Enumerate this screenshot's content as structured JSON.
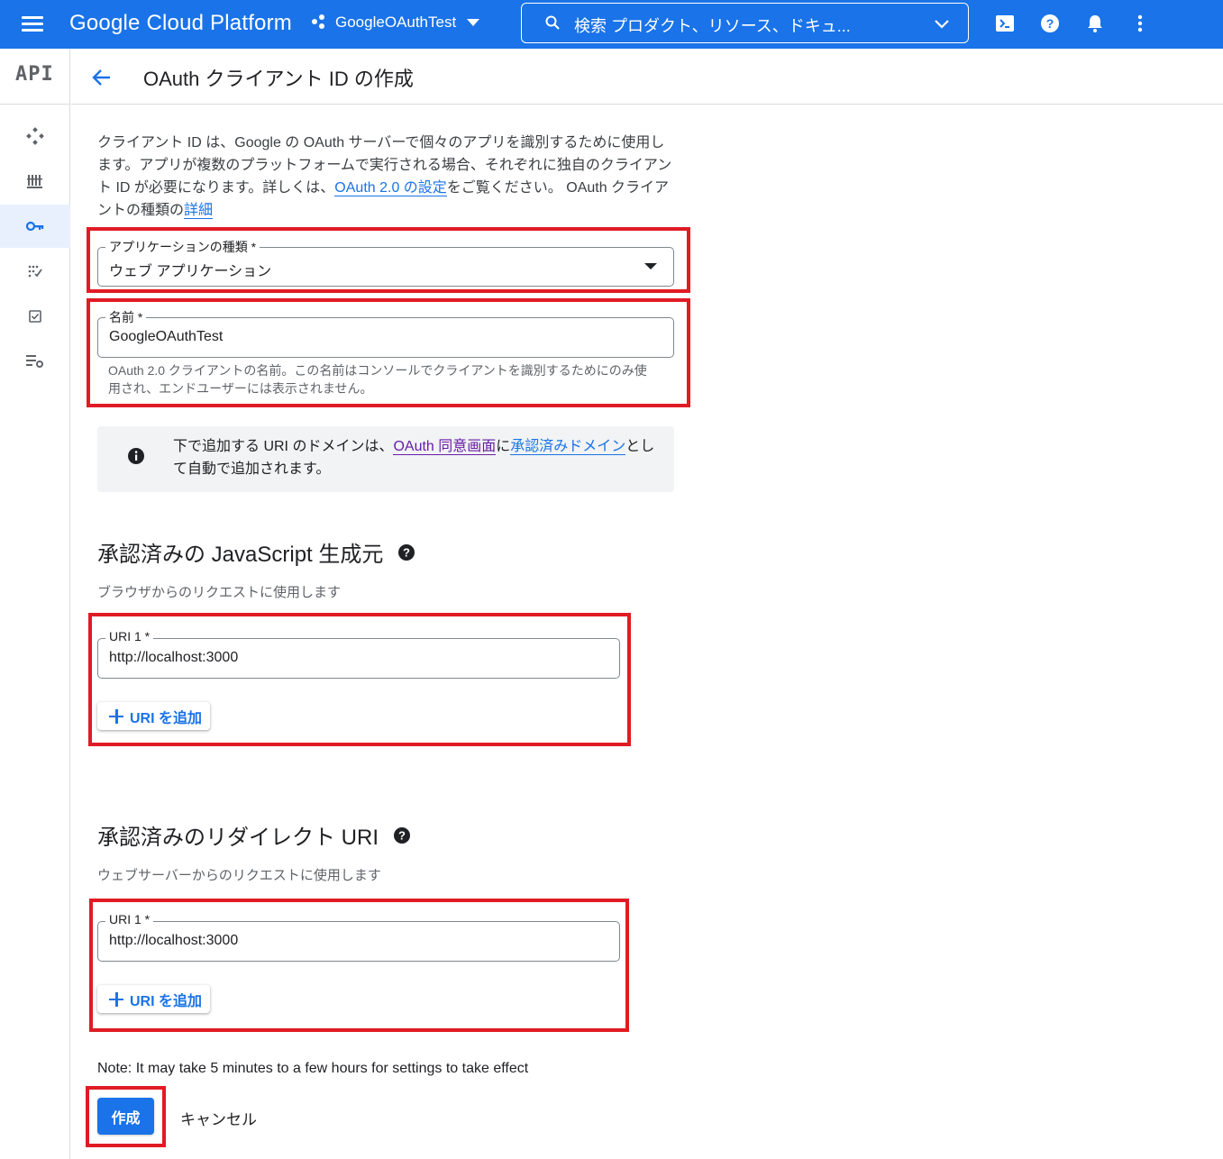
{
  "topbar": {
    "brand": "Google Cloud Platform",
    "project": "GoogleOAuthTest",
    "search_text": "検索  プロダクト、リソース、ドキュ..."
  },
  "rail": {
    "logo": "API",
    "items": [
      {
        "icon": "dashboard-icon"
      },
      {
        "icon": "library-icon"
      },
      {
        "icon": "key-icon",
        "active": true
      },
      {
        "icon": "consent-icon"
      },
      {
        "icon": "checkbox-icon"
      },
      {
        "icon": "settings-list-icon"
      }
    ]
  },
  "header": {
    "title": "OAuth クライアント ID の作成"
  },
  "intro": {
    "text1": "クライアント ID は、Google の OAuth サーバーで個々のアプリを識別するために使用します。アプリが複数のプラットフォームで実行される場合、それぞれに独自のクライアント ID が必要になります。詳しくは、",
    "link1": "OAuth 2.0 の設定",
    "text2": "をご覧ください。 OAuth クライアントの種類の",
    "link2": "詳細"
  },
  "app_type": {
    "label": "アプリケーションの種類 *",
    "value": "ウェブ アプリケーション"
  },
  "name_field": {
    "label": "名前 *",
    "value": "GoogleOAuthTest",
    "hint": "OAuth 2.0 クライアントの名前。この名前はコンソールでクライアントを識別するためにのみ使用され、エンドユーザーには表示されません。"
  },
  "info": {
    "text1": "下で追加する URI のドメインは、",
    "link1": "OAuth 同意画面",
    "text2": "に",
    "link2": "承認済みドメイン",
    "text3": "として自動で追加されます。"
  },
  "js_origins": {
    "title": "承認済みの JavaScript 生成元",
    "desc": "ブラウザからのリクエストに使用します",
    "uri_label": "URI 1 *",
    "uri_value": "http://localhost:3000",
    "add_label": "URI を追加"
  },
  "redirect_uris": {
    "title": "承認済みのリダイレクト URI",
    "desc": "ウェブサーバーからのリクエストに使用します",
    "uri_label": "URI 1 *",
    "uri_value": "http://localhost:3000",
    "add_label": "URI を追加"
  },
  "footer": {
    "note": "Note: It may take 5 minutes to a few hours for settings to take effect",
    "create_label": "作成",
    "cancel_label": "キャンセル"
  },
  "colors": {
    "brand_blue": "#1a73e8",
    "highlight_red": "#e01b24",
    "visited_purple": "#681da8"
  }
}
